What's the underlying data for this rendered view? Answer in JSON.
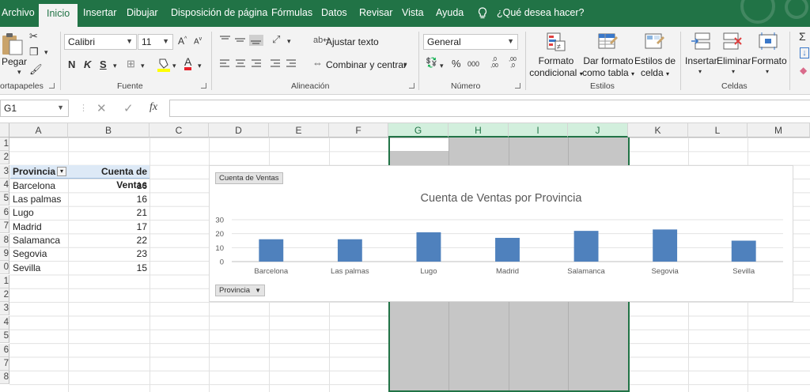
{
  "tabs": [
    {
      "label": "Archivo",
      "active": false
    },
    {
      "label": "Inicio",
      "active": true
    },
    {
      "label": "Insertar",
      "active": false
    },
    {
      "label": "Dibujar",
      "active": false
    },
    {
      "label": "Disposición de página",
      "active": false
    },
    {
      "label": "Fórmulas",
      "active": false
    },
    {
      "label": "Datos",
      "active": false
    },
    {
      "label": "Revisar",
      "active": false
    },
    {
      "label": "Vista",
      "active": false
    },
    {
      "label": "Ayuda",
      "active": false
    }
  ],
  "tell_me": "¿Qué desea hacer?",
  "ribbon": {
    "clipboard": {
      "paste_label": "Pegar",
      "group_label": "ortapapeles"
    },
    "font": {
      "name": "Calibri",
      "size": "11",
      "grow": "A",
      "shrink": "A",
      "bold": "N",
      "italic": "K",
      "underline": "S",
      "font_color_glyph": "A",
      "group_label": "Fuente"
    },
    "alignment": {
      "wrap_text": "Ajustar texto",
      "merge_center": "Combinar y centrar",
      "group_label": "Alineación"
    },
    "number": {
      "format": "General",
      "percent": "%",
      "thousands": "000",
      "inc_decimal": ",0 ,00",
      "dec_decimal": ",00 ,0",
      "group_label": "Número"
    },
    "styles": {
      "conditional": [
        "Formato",
        "condicional"
      ],
      "table": [
        "Dar formato",
        "como tabla"
      ],
      "cell_styles": [
        "Estilos de",
        "celda"
      ],
      "group_label": "Estilos"
    },
    "cells": {
      "insert": "Insertar",
      "delete": "Eliminar",
      "format": "Formato",
      "group_label": "Celdas"
    }
  },
  "formula_bar": {
    "name_box": "G1",
    "cancel": "✕",
    "enter": "✓",
    "fx": "fx",
    "value": ""
  },
  "columns": [
    "A",
    "B",
    "C",
    "D",
    "E",
    "F",
    "G",
    "H",
    "I",
    "J",
    "K",
    "L",
    "M"
  ],
  "selected_columns": [
    "G",
    "H",
    "I",
    "J"
  ],
  "rows": [
    "1",
    "2",
    "3",
    "4",
    "5",
    "6",
    "7",
    "8",
    "9",
    "0",
    "1",
    "2",
    "3",
    "4",
    "5",
    "6",
    "7",
    "8"
  ],
  "pivot": {
    "header_row": "Provincia",
    "header_value": "Cuenta de Ventas",
    "filter_glyph": "▾",
    "rows": [
      {
        "label": "Barcelona",
        "value": "16"
      },
      {
        "label": "Las palmas",
        "value": "16"
      },
      {
        "label": "Lugo",
        "value": "21"
      },
      {
        "label": "Madrid",
        "value": "17"
      },
      {
        "label": "Salamanca",
        "value": "22"
      },
      {
        "label": "Segovia",
        "value": "23"
      },
      {
        "label": "Sevilla",
        "value": "15"
      }
    ]
  },
  "chart_field_buttons": {
    "values": "Cuenta de Ventas",
    "axis": "Provincia"
  },
  "chart_data": {
    "type": "bar",
    "title": "Cuenta de Ventas por Provincia",
    "categories": [
      "Barcelona",
      "Las palmas",
      "Lugo",
      "Madrid",
      "Salamanca",
      "Segovia",
      "Sevilla"
    ],
    "values": [
      16,
      16,
      21,
      17,
      22,
      23,
      15
    ],
    "ylim": [
      0,
      30
    ],
    "yticks": [
      0,
      10,
      20,
      30
    ],
    "xlabel": "",
    "ylabel": "",
    "grid": true,
    "legend": "none",
    "bar_color": "#4f81bd"
  },
  "colors": {
    "accent": "#217346",
    "pivot_header": "#dde9f6"
  }
}
